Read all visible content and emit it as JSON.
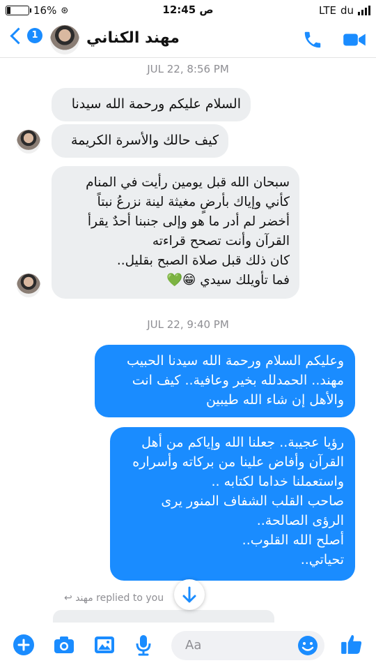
{
  "status_bar": {
    "battery": "16%",
    "battery_level": 0.16,
    "time": "12:45 ص",
    "network": "LTE",
    "carrier": "du"
  },
  "header": {
    "unread_count": "1",
    "contact_name": "مهند الكناني"
  },
  "thread": {
    "timestamp_1": "JUL 22, 8:56 PM",
    "timestamp_2": "JUL 22, 9:40 PM",
    "incoming": [
      {
        "lines": [
          "السلام عليكم ورحمة الله سيدنا"
        ]
      },
      {
        "lines": [
          "كيف حالك والأسرة الكريمة"
        ]
      },
      {
        "lines": [
          "سبحان الله قبل يومين  رأيت في المنام",
          "كأني وإياك بأرضٍ مغيثة لينة نزرعُ نبتاً",
          "أخضر لم أدر ما هو وإلى جنبنا أحدٌ يقرأ",
          "القرآن وأنت تصحح قراءته",
          "كان ذلك قبل صلاة الصبح بقليل..",
          "فما تأويلك سيدي 😁💚"
        ]
      }
    ],
    "outgoing": [
      {
        "lines": [
          "وعليكم السلام ورحمة الله سيدنا الحبيب",
          "مهند.. الحمدلله بخير وعافية.. كيف انت",
          "والأهل إن شاء الله طيبين"
        ]
      },
      {
        "lines": [
          "رؤيا عجيبة.. جعلنا الله وإياكم من أهل",
          "القرآن وأفاض علينا من بركاته وأسراره",
          "واستعملنا خداما لكتابه ..",
          "صاحب القلب الشفاف المنور يرى",
          "الرؤى الصالحة..",
          "أصلح الله القلوب..",
          "تحياتي.."
        ]
      }
    ],
    "replied_note": "مهند replied to you"
  },
  "composer": {
    "placeholder": "Aa"
  },
  "colors": {
    "accent": "#1a8cff",
    "incoming_bubble": "#eceef0"
  },
  "icons": [
    "chevron-left-icon",
    "phone-icon",
    "video-camera-icon",
    "plus-icon",
    "camera-icon",
    "image-icon",
    "microphone-icon",
    "emoji-icon",
    "thumbs-up-icon",
    "arrow-down-icon",
    "reply-icon"
  ]
}
